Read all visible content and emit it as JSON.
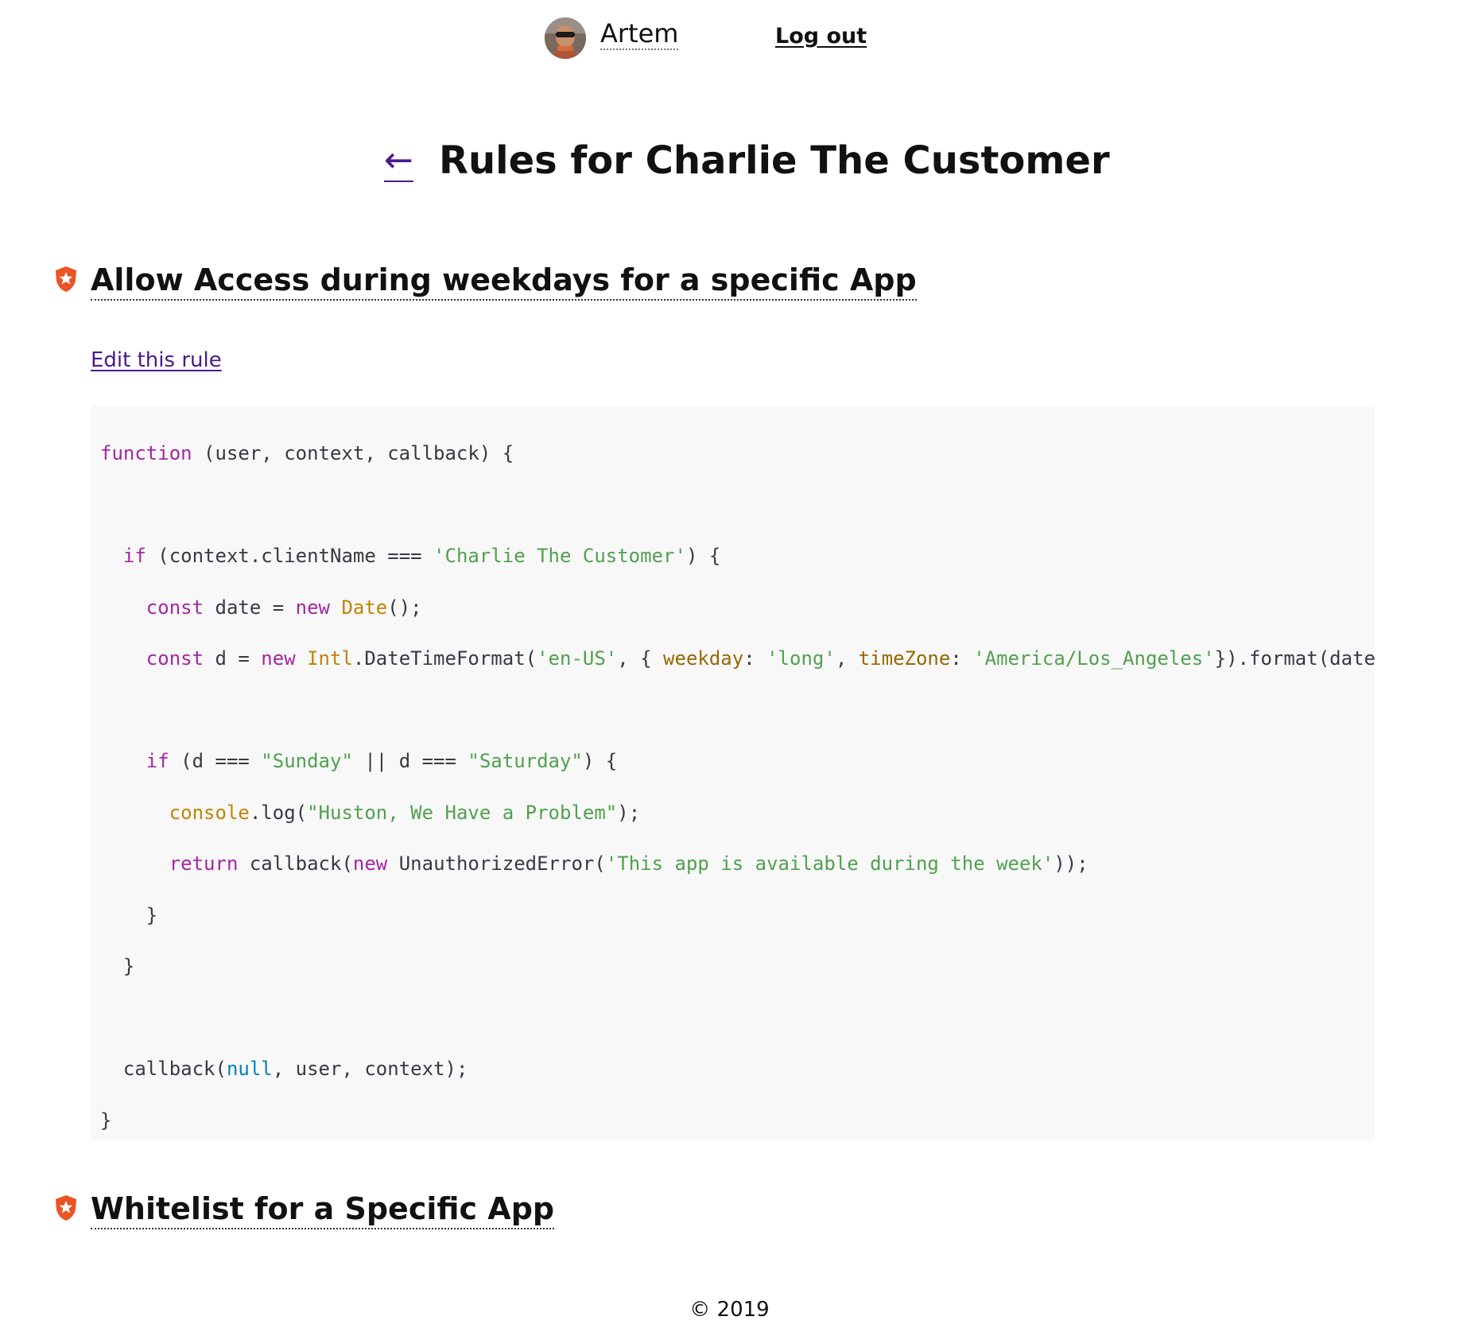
{
  "header": {
    "username": "Artem",
    "logout_label": "Log out"
  },
  "page": {
    "back_arrow": "←",
    "title": "Rules for Charlie The Customer"
  },
  "rules": [
    {
      "title": "Allow Access during weekdays for a specific App",
      "edit_label": "Edit this rule",
      "code_lines": [
        "function (user, context, callback) {",
        "",
        "  if (context.clientName === 'Charlie The Customer') {",
        "    const date = new Date();",
        "    const d = new Intl.DateTimeFormat('en-US', { weekday: 'long', timeZone: 'America/Los_Angeles'}).format(date);",
        "",
        "    if (d === \"Sunday\" || d === \"Saturday\") {",
        "      console.log(\"Huston, We Have a Problem\");",
        "      return callback(new UnauthorizedError('This app is available during the week'));",
        "    }",
        "  }",
        "",
        "  callback(null, user, context);",
        "}"
      ]
    },
    {
      "title": "Whitelist for a Specific App"
    }
  ],
  "footer": {
    "copyright": "© 2019"
  },
  "colors": {
    "link": "#4b1a8a",
    "rule_icon": "#eb5424",
    "code_background": "#f8f8f8",
    "code_keyword": "#a626a4",
    "code_string": "#50a14f",
    "code_class": "#c18401",
    "code_property": "#986801",
    "code_literal": "#0184bc"
  },
  "icons": {
    "rule_icon": "auth0-shield-icon",
    "avatar": "user-avatar"
  }
}
